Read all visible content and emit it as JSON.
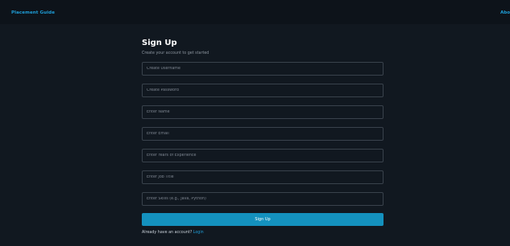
{
  "nav": {
    "brand": "Placement Guide",
    "about": "Abo"
  },
  "form": {
    "title": "Sign Up",
    "subtitle": "Create your account to get started",
    "fields": {
      "username_placeholder": "Create Username",
      "password_placeholder": "Create Password",
      "name_placeholder": "Enter Name",
      "email_placeholder": "Enter Email",
      "experience_placeholder": "Enter Years of Experience",
      "job_title_placeholder": "Enter Job Title",
      "skills_placeholder": "Enter Skills (e.g., Java, Python)"
    },
    "submit_label": "Sign Up",
    "footer_text": "Already have an account?",
    "login_link": "Login"
  },
  "colors": {
    "background": "#111820",
    "accent": "#1491be",
    "link": "#1e9ed8",
    "border": "#39424c"
  }
}
